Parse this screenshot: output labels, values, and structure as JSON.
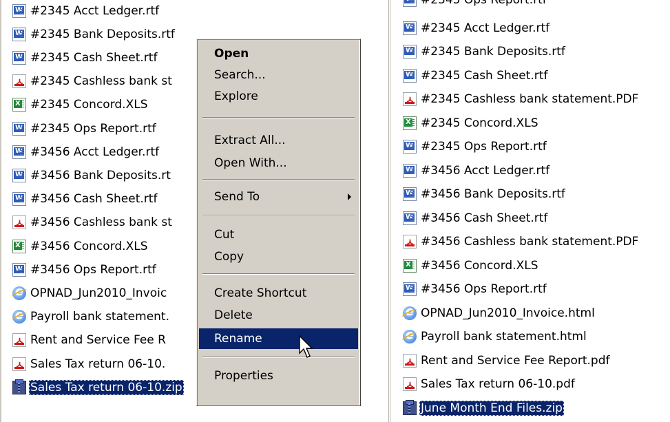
{
  "left_pane": {
    "files": [
      {
        "name": "#2345 Acct Ledger.rtf",
        "type": "doc"
      },
      {
        "name": "#2345 Bank Deposits.rtf",
        "type": "doc"
      },
      {
        "name": "#2345 Cash Sheet.rtf",
        "type": "doc"
      },
      {
        "name": "#2345 Cashless bank st",
        "type": "pdf"
      },
      {
        "name": "#2345 Concord.XLS",
        "type": "xls"
      },
      {
        "name": "#2345 Ops Report.rtf",
        "type": "doc"
      },
      {
        "name": "#3456 Acct Ledger.rtf",
        "type": "doc"
      },
      {
        "name": "#3456 Bank Deposits.rt",
        "type": "doc"
      },
      {
        "name": "#3456 Cash Sheet.rtf",
        "type": "doc"
      },
      {
        "name": "#3456 Cashless bank st",
        "type": "pdf"
      },
      {
        "name": "#3456 Concord.XLS",
        "type": "xls"
      },
      {
        "name": "#3456 Ops Report.rtf",
        "type": "doc"
      },
      {
        "name": "OPNAD_Jun2010_Invoic",
        "type": "html"
      },
      {
        "name": "Payroll bank statement.",
        "type": "html"
      },
      {
        "name": "Rent and Service Fee R",
        "type": "pdf"
      },
      {
        "name": "Sales Tax return 06-10.",
        "type": "pdf"
      },
      {
        "name": "Sales Tax return 06-10.zip",
        "type": "zip",
        "selected": true
      }
    ]
  },
  "context_menu": {
    "open": "Open",
    "search": "Search...",
    "explore": "Explore",
    "extract_all": "Extract All...",
    "open_with": "Open With...",
    "send_to": "Send To",
    "cut": "Cut",
    "copy": "Copy",
    "create_shortcut": "Create Shortcut",
    "delete": "Delete",
    "rename": "Rename",
    "properties": "Properties"
  },
  "right_pane": {
    "partial_top": "#2345 Ops Report.rtf",
    "files": [
      {
        "name": "#2345 Acct Ledger.rtf",
        "type": "doc"
      },
      {
        "name": "#2345 Bank Deposits.rtf",
        "type": "doc"
      },
      {
        "name": "#2345 Cash Sheet.rtf",
        "type": "doc"
      },
      {
        "name": "#2345 Cashless bank statement.PDF",
        "type": "pdf"
      },
      {
        "name": "#2345 Concord.XLS",
        "type": "xls"
      },
      {
        "name": "#2345 Ops Report.rtf",
        "type": "doc"
      },
      {
        "name": "#3456 Acct Ledger.rtf",
        "type": "doc"
      },
      {
        "name": "#3456 Bank Deposits.rtf",
        "type": "doc"
      },
      {
        "name": "#3456 Cash Sheet.rtf",
        "type": "doc"
      },
      {
        "name": "#3456 Cashless bank statement.PDF",
        "type": "pdf"
      },
      {
        "name": "#3456 Concord.XLS",
        "type": "xls"
      },
      {
        "name": "#3456 Ops Report.rtf",
        "type": "doc"
      },
      {
        "name": "OPNAD_Jun2010_Invoice.html",
        "type": "html"
      },
      {
        "name": "Payroll bank statement.html",
        "type": "html"
      },
      {
        "name": "Rent and Service Fee Report.pdf",
        "type": "pdf"
      },
      {
        "name": "Sales Tax return 06-10.pdf",
        "type": "pdf"
      },
      {
        "name": "June Month End Files.zip",
        "type": "zip",
        "selected": true
      }
    ]
  },
  "colors": {
    "selection": "#0a246a",
    "menu_bg": "#d4d0c8"
  },
  "icons": {
    "doc": "word-document-icon",
    "pdf": "pdf-document-icon",
    "xls": "excel-spreadsheet-icon",
    "html": "internet-explorer-html-icon",
    "zip": "zip-folder-icon"
  }
}
